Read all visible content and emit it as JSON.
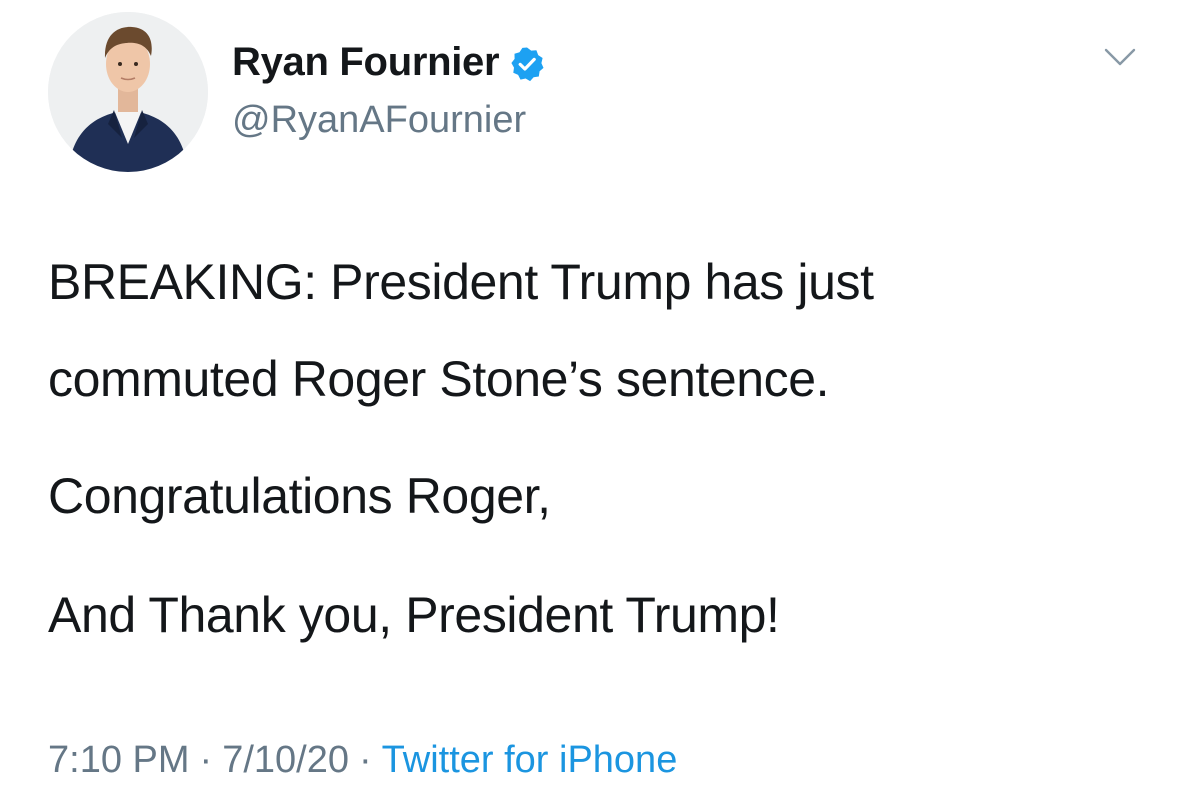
{
  "user": {
    "display_name": "Ryan Fournier",
    "handle": "@RyanAFournier",
    "verified": true,
    "avatar_icon": "profile-photo"
  },
  "tweet": {
    "lines": [
      "BREAKING: President Trump has just",
      "commuted Roger Stone’s sentence.",
      "Congratulations Roger,",
      "And Thank you, President Trump!"
    ],
    "time": "7:10 PM",
    "date": "7/10/20",
    "separator": "·",
    "source": "Twitter for iPhone"
  },
  "colors": {
    "text": "#14171a",
    "secondary": "#657786",
    "link": "#1b95e0",
    "verified": "#1da1f2"
  },
  "icons": {
    "menu": "chevron-down-icon",
    "verified": "verified-badge-icon"
  }
}
